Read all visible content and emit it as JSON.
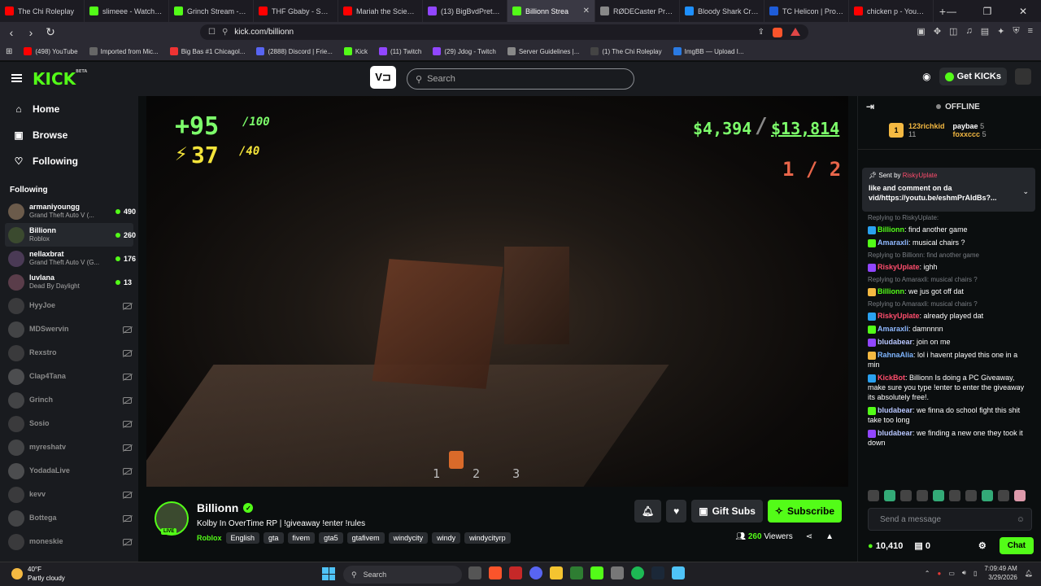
{
  "browser": {
    "tabs": [
      {
        "title": "The Chi Roleplay",
        "color": "#ff0000"
      },
      {
        "title": "slimeee - Watch clip",
        "color": "#53fc18"
      },
      {
        "title": "Grinch Stream - Wa",
        "color": "#53fc18"
      },
      {
        "title": "THF Gbaby - SCOOT",
        "color": "#ff0000"
      },
      {
        "title": "Mariah the Scientis",
        "color": "#ff0000"
      },
      {
        "title": "(13) BigBvdPretty -",
        "color": "#9146ff"
      },
      {
        "title": "Billionn Strea",
        "color": "#53fc18"
      },
      {
        "title": "RØDECaster Pro | Pc",
        "color": "#888888"
      },
      {
        "title": "Bloody Shark Crazy",
        "color": "#1e90ff"
      },
      {
        "title": "TC Helicon | Produc",
        "color": "#1e5cd8"
      },
      {
        "title": "chicken p - YouTub",
        "color": "#ff0000"
      }
    ],
    "url": "kick.com/billionn",
    "bookmarks": [
      {
        "label": "(498) YouTube",
        "color": "#ff0000"
      },
      {
        "label": "Imported from Mic...",
        "color": "#666"
      },
      {
        "label": "Big Bas #1 Chicagol...",
        "color": "#e33"
      },
      {
        "label": "(2888) Discord | Frie...",
        "color": "#5865f2"
      },
      {
        "label": "Kick",
        "color": "#53fc18"
      },
      {
        "label": "(11) Twitch",
        "color": "#9146ff"
      },
      {
        "label": "(29) Jdog - Twitch",
        "color": "#9146ff"
      },
      {
        "label": "Server Guidelines |...",
        "color": "#888"
      },
      {
        "label": "(1) The Chi Roleplay",
        "color": "#444"
      },
      {
        "label": "ImgBB — Upload I...",
        "color": "#2a7ae2"
      }
    ]
  },
  "header": {
    "logo": "KICK",
    "logo_tag": "BETA",
    "search_placeholder": "Search",
    "get_kicks": "Get KICKs"
  },
  "sidebar": {
    "nav": [
      {
        "label": "Home",
        "icon": "home-icon"
      },
      {
        "label": "Browse",
        "icon": "browse-icon"
      },
      {
        "label": "Following",
        "icon": "heart-icon"
      }
    ],
    "following_title": "Following",
    "channels": [
      {
        "name": "armaniyoungg",
        "game": "Grand Theft Auto V (...",
        "viewers": "490",
        "live": true
      },
      {
        "name": "Billionn",
        "game": "Roblox",
        "viewers": "260",
        "live": true
      },
      {
        "name": "nellaxbrat",
        "game": "Grand Theft Auto V (G...",
        "viewers": "176",
        "live": true
      },
      {
        "name": "luvlana",
        "game": "Dead By Daylight",
        "viewers": "13",
        "live": true
      },
      {
        "name": "HyyJoe",
        "live": false
      },
      {
        "name": "MDSwervin",
        "live": false
      },
      {
        "name": "Rexstro",
        "live": false
      },
      {
        "name": "Clap4Tana",
        "live": false
      },
      {
        "name": "Grinch",
        "live": false
      },
      {
        "name": "Sosio",
        "live": false
      },
      {
        "name": "myreshatv",
        "live": false
      },
      {
        "name": "YodadaLive",
        "live": false
      },
      {
        "name": "kevv",
        "live": false
      },
      {
        "name": "Bottega",
        "live": false
      },
      {
        "name": "moneskie",
        "live": false
      }
    ]
  },
  "game_hud": {
    "health": "+95",
    "health_max": "/100",
    "armor": "37",
    "armor_max": "/40",
    "cash": "$4,394",
    "bank": "$13,814",
    "ammo": "1 / 2",
    "slots": [
      "1",
      "2",
      "3"
    ]
  },
  "stream": {
    "name": "Billionn",
    "title": "Kolby In OverTime RP | !giveaway !enter !rules",
    "category": "Roblox",
    "tags": [
      "English",
      "gta",
      "fivem",
      "gta5",
      "gtafivem",
      "windycity",
      "windy",
      "windycityrp"
    ],
    "viewers": "260",
    "viewers_label": "Viewers",
    "live_badge": "LIVE",
    "gift_label": "Gift Subs",
    "subscribe_label": "Subscribe"
  },
  "chat": {
    "status": "OFFLINE",
    "leaderboard": {
      "rank": "1",
      "top": "123richkid",
      "top_count": "11",
      "second": "paybae",
      "second_count": "5",
      "third": "foxxccc",
      "third_count": "5"
    },
    "pinned": {
      "sent_by_label": "Sent by",
      "sender": "RiskyUplate",
      "text": "like and comment on da vid/https://youtu.be/eshmPrAIdBs?..."
    },
    "messages": [
      {
        "reply": "Replying to RiskyUplate:",
        "user": "Billionn",
        "color": "#53fc18",
        "text": "find another game"
      },
      {
        "user": "Amaraxli",
        "color": "#8fb8ff",
        "text": "musical chairs ?"
      },
      {
        "reply": "Replying to Billionn: find another game",
        "user": "RiskyUplate",
        "color": "#ff4d6d",
        "text": "ighh"
      },
      {
        "reply": "Replying to Amaraxli: musical chairs ?",
        "user": "Billionn",
        "color": "#53fc18",
        "text": "we jus got off dat"
      },
      {
        "reply": "Replying to Amaraxli: musical chairs ?",
        "user": "RiskyUplate",
        "color": "#ff4d6d",
        "text": "already played dat"
      },
      {
        "user": "Amaraxli",
        "color": "#8fb8ff",
        "text": "damnnnn"
      },
      {
        "user": "bludabear",
        "color": "#b8c6ff",
        "text": "join on me"
      },
      {
        "user": "RahnaAlia",
        "color": "#7fb6ff",
        "text": "lol i havent played this one in a min"
      },
      {
        "user": "KickBot",
        "color": "#ff4d6d",
        "text": "Billionn Is doing a PC Giveaway, make sure you type !enter to enter the giveaway its absolutely free!."
      },
      {
        "user": "bludabear",
        "color": "#b8c6ff",
        "text": "we finna do school fight this shit take too long"
      },
      {
        "user": "bludabear",
        "color": "#b8c6ff",
        "text": "we finding a new one they took it down"
      }
    ],
    "input_placeholder": "Send a message",
    "kicks": "10,410",
    "points": "0",
    "chat_button": "Chat"
  },
  "taskbar": {
    "temp": "40°F",
    "weather": "Partly cloudy",
    "search": "Search",
    "time": "7:09:49 AM",
    "date": "3/29/2026"
  }
}
